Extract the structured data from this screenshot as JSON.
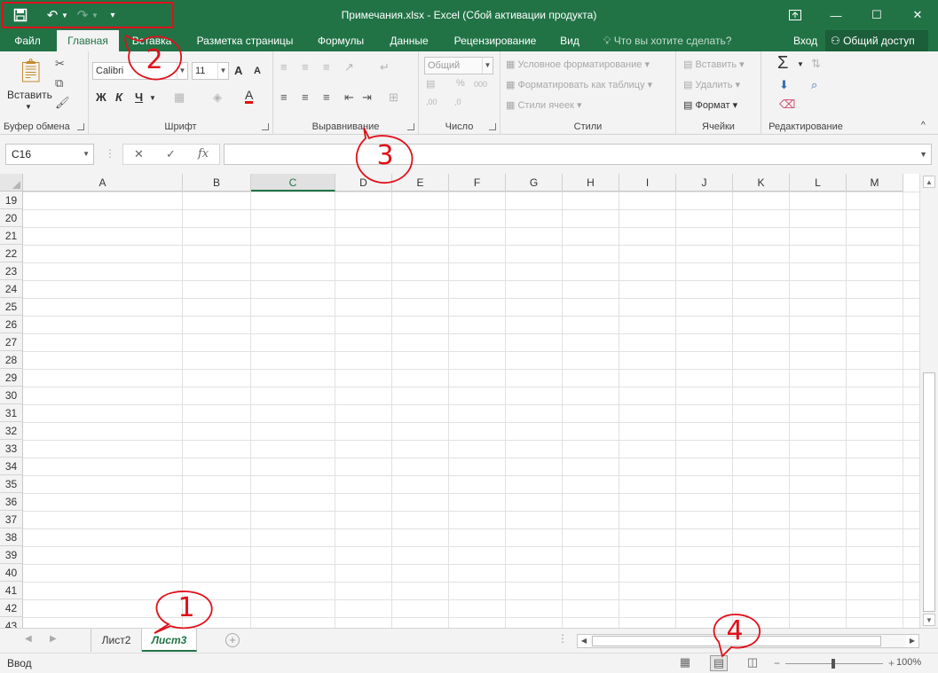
{
  "window": {
    "title": "Примечания.xlsx - Excel (Сбой активации продукта)"
  },
  "qat": {
    "save_icon": "save-icon",
    "undo_icon": "undo-icon",
    "redo_icon": "redo-icon",
    "customize_icon": "customize-qat-icon"
  },
  "tabs": [
    {
      "label": "Файл"
    },
    {
      "label": "Главная"
    },
    {
      "label": "Вставка"
    },
    {
      "label": "Разметка страницы"
    },
    {
      "label": "Формулы"
    },
    {
      "label": "Данные"
    },
    {
      "label": "Рецензирование"
    },
    {
      "label": "Вид"
    }
  ],
  "tell_me": "Что вы хотите сделать?",
  "signin": "Вход",
  "share": "Общий доступ",
  "ribbon": {
    "clipboard": {
      "group": "Буфер обмена",
      "paste": "Вставить"
    },
    "font": {
      "group": "Шрифт",
      "font_name": "Calibri",
      "font_size": "11",
      "bold": "Ж",
      "italic": "К",
      "underline": "Ч",
      "grow": "A",
      "shrink": "A",
      "color_letter": "A"
    },
    "alignment": {
      "group": "Выравнивание"
    },
    "number": {
      "group": "Число",
      "format": "Общий"
    },
    "styles": {
      "group": "Стили",
      "conditional": "Условное форматирование",
      "as_table": "Форматировать как таблицу",
      "cell_styles": "Стили ячеек"
    },
    "cells": {
      "group": "Ячейки",
      "insert": "Вставить",
      "delete": "Удалить",
      "format": "Формат"
    },
    "editing": {
      "group": "Редактирование",
      "sum": "Σ"
    }
  },
  "formula_bar": {
    "name_box": "C16",
    "cancel": "✕",
    "enter": "✓",
    "fx": "fx",
    "value": ""
  },
  "grid": {
    "columns": [
      "A",
      "B",
      "C",
      "D",
      "E",
      "F",
      "G",
      "H",
      "I",
      "J",
      "K",
      "L",
      "M"
    ],
    "selected_column": "C",
    "rows": [
      "19",
      "20",
      "21",
      "22",
      "23",
      "24",
      "25",
      "26",
      "27",
      "28",
      "29",
      "30",
      "31",
      "32",
      "33",
      "34",
      "35",
      "36",
      "37",
      "38",
      "39",
      "40",
      "41",
      "42",
      "43"
    ]
  },
  "sheets": [
    {
      "label": "Лист2",
      "active": false
    },
    {
      "label": "Лист3",
      "active": true
    }
  ],
  "status": {
    "mode": "Ввод",
    "zoom": "100%"
  },
  "annotations": [
    "1",
    "2",
    "3",
    "4"
  ],
  "colors": {
    "accent": "#217346",
    "annotation": "#e0101a"
  }
}
